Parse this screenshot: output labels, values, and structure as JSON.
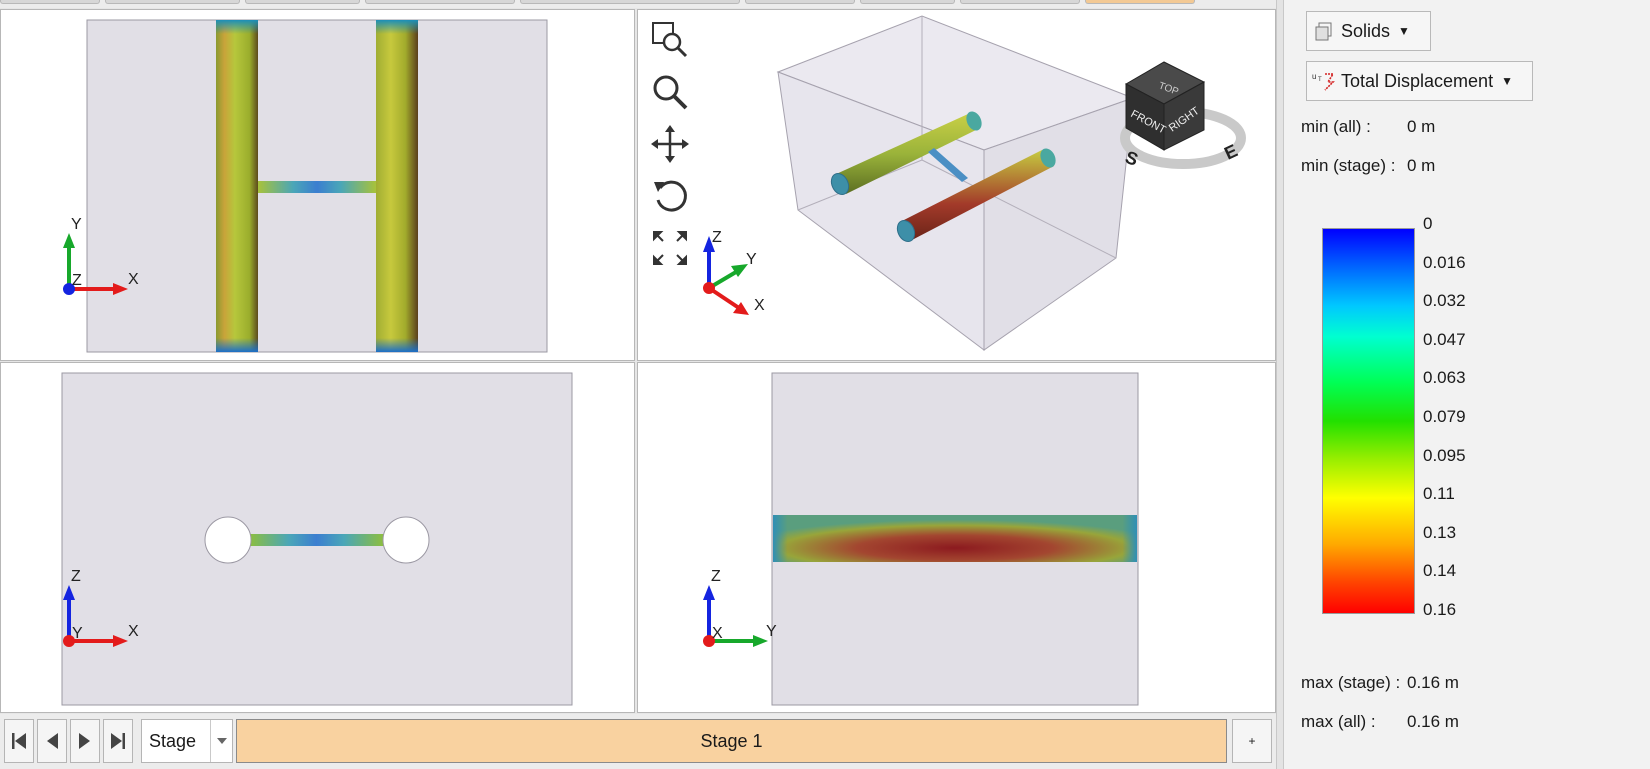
{
  "viewports": {
    "top": {
      "axis_vertical": "Y",
      "axis_horizontal": "X",
      "axis_out": "Z"
    },
    "perspective": {
      "axis_z": "Z",
      "axis_y": "Y",
      "axis_x": "X",
      "view_cube": {
        "top": "TOP",
        "front": "FRONT",
        "right": "RIGHT",
        "compass_s": "S",
        "compass_e": "E"
      },
      "tools": [
        "zoom-window-icon",
        "zoom-icon",
        "pan-icon",
        "rotate-icon",
        "fit-extents-icon"
      ]
    },
    "front": {
      "axis_vertical": "Z",
      "axis_horizontal": "X",
      "axis_out": "Y"
    },
    "side": {
      "axis_vertical": "Z",
      "axis_horizontal": "Y",
      "axis_out": "X"
    }
  },
  "stage_bar": {
    "nav": [
      "first-stage-icon",
      "previous-stage-icon",
      "next-stage-icon",
      "last-stage-icon"
    ],
    "selector_label": "Stage",
    "current_stage": "Stage 1",
    "add_label": "+"
  },
  "panel": {
    "display_mode": "Solids",
    "result_type": "Total Displacement",
    "min_all_label": "min (all) :",
    "min_all_value": "0 m",
    "min_stage_label": "min (stage) :",
    "min_stage_value": "0 m",
    "legend_ticks": [
      "0",
      "0.016",
      "0.032",
      "0.047",
      "0.063",
      "0.079",
      "0.095",
      "0.11",
      "0.13",
      "0.14",
      "0.16"
    ],
    "max_stage_label": "max (stage) :",
    "max_stage_value": "0.16 m",
    "max_all_label": "max (all) :",
    "max_all_value": "0.16 m"
  },
  "colors": {
    "stage_highlight": "#f9d2a0",
    "axis_x": "#e31b1b",
    "axis_y": "#17a82b",
    "axis_z": "#1424e0",
    "soil": "#e1dfe6"
  }
}
